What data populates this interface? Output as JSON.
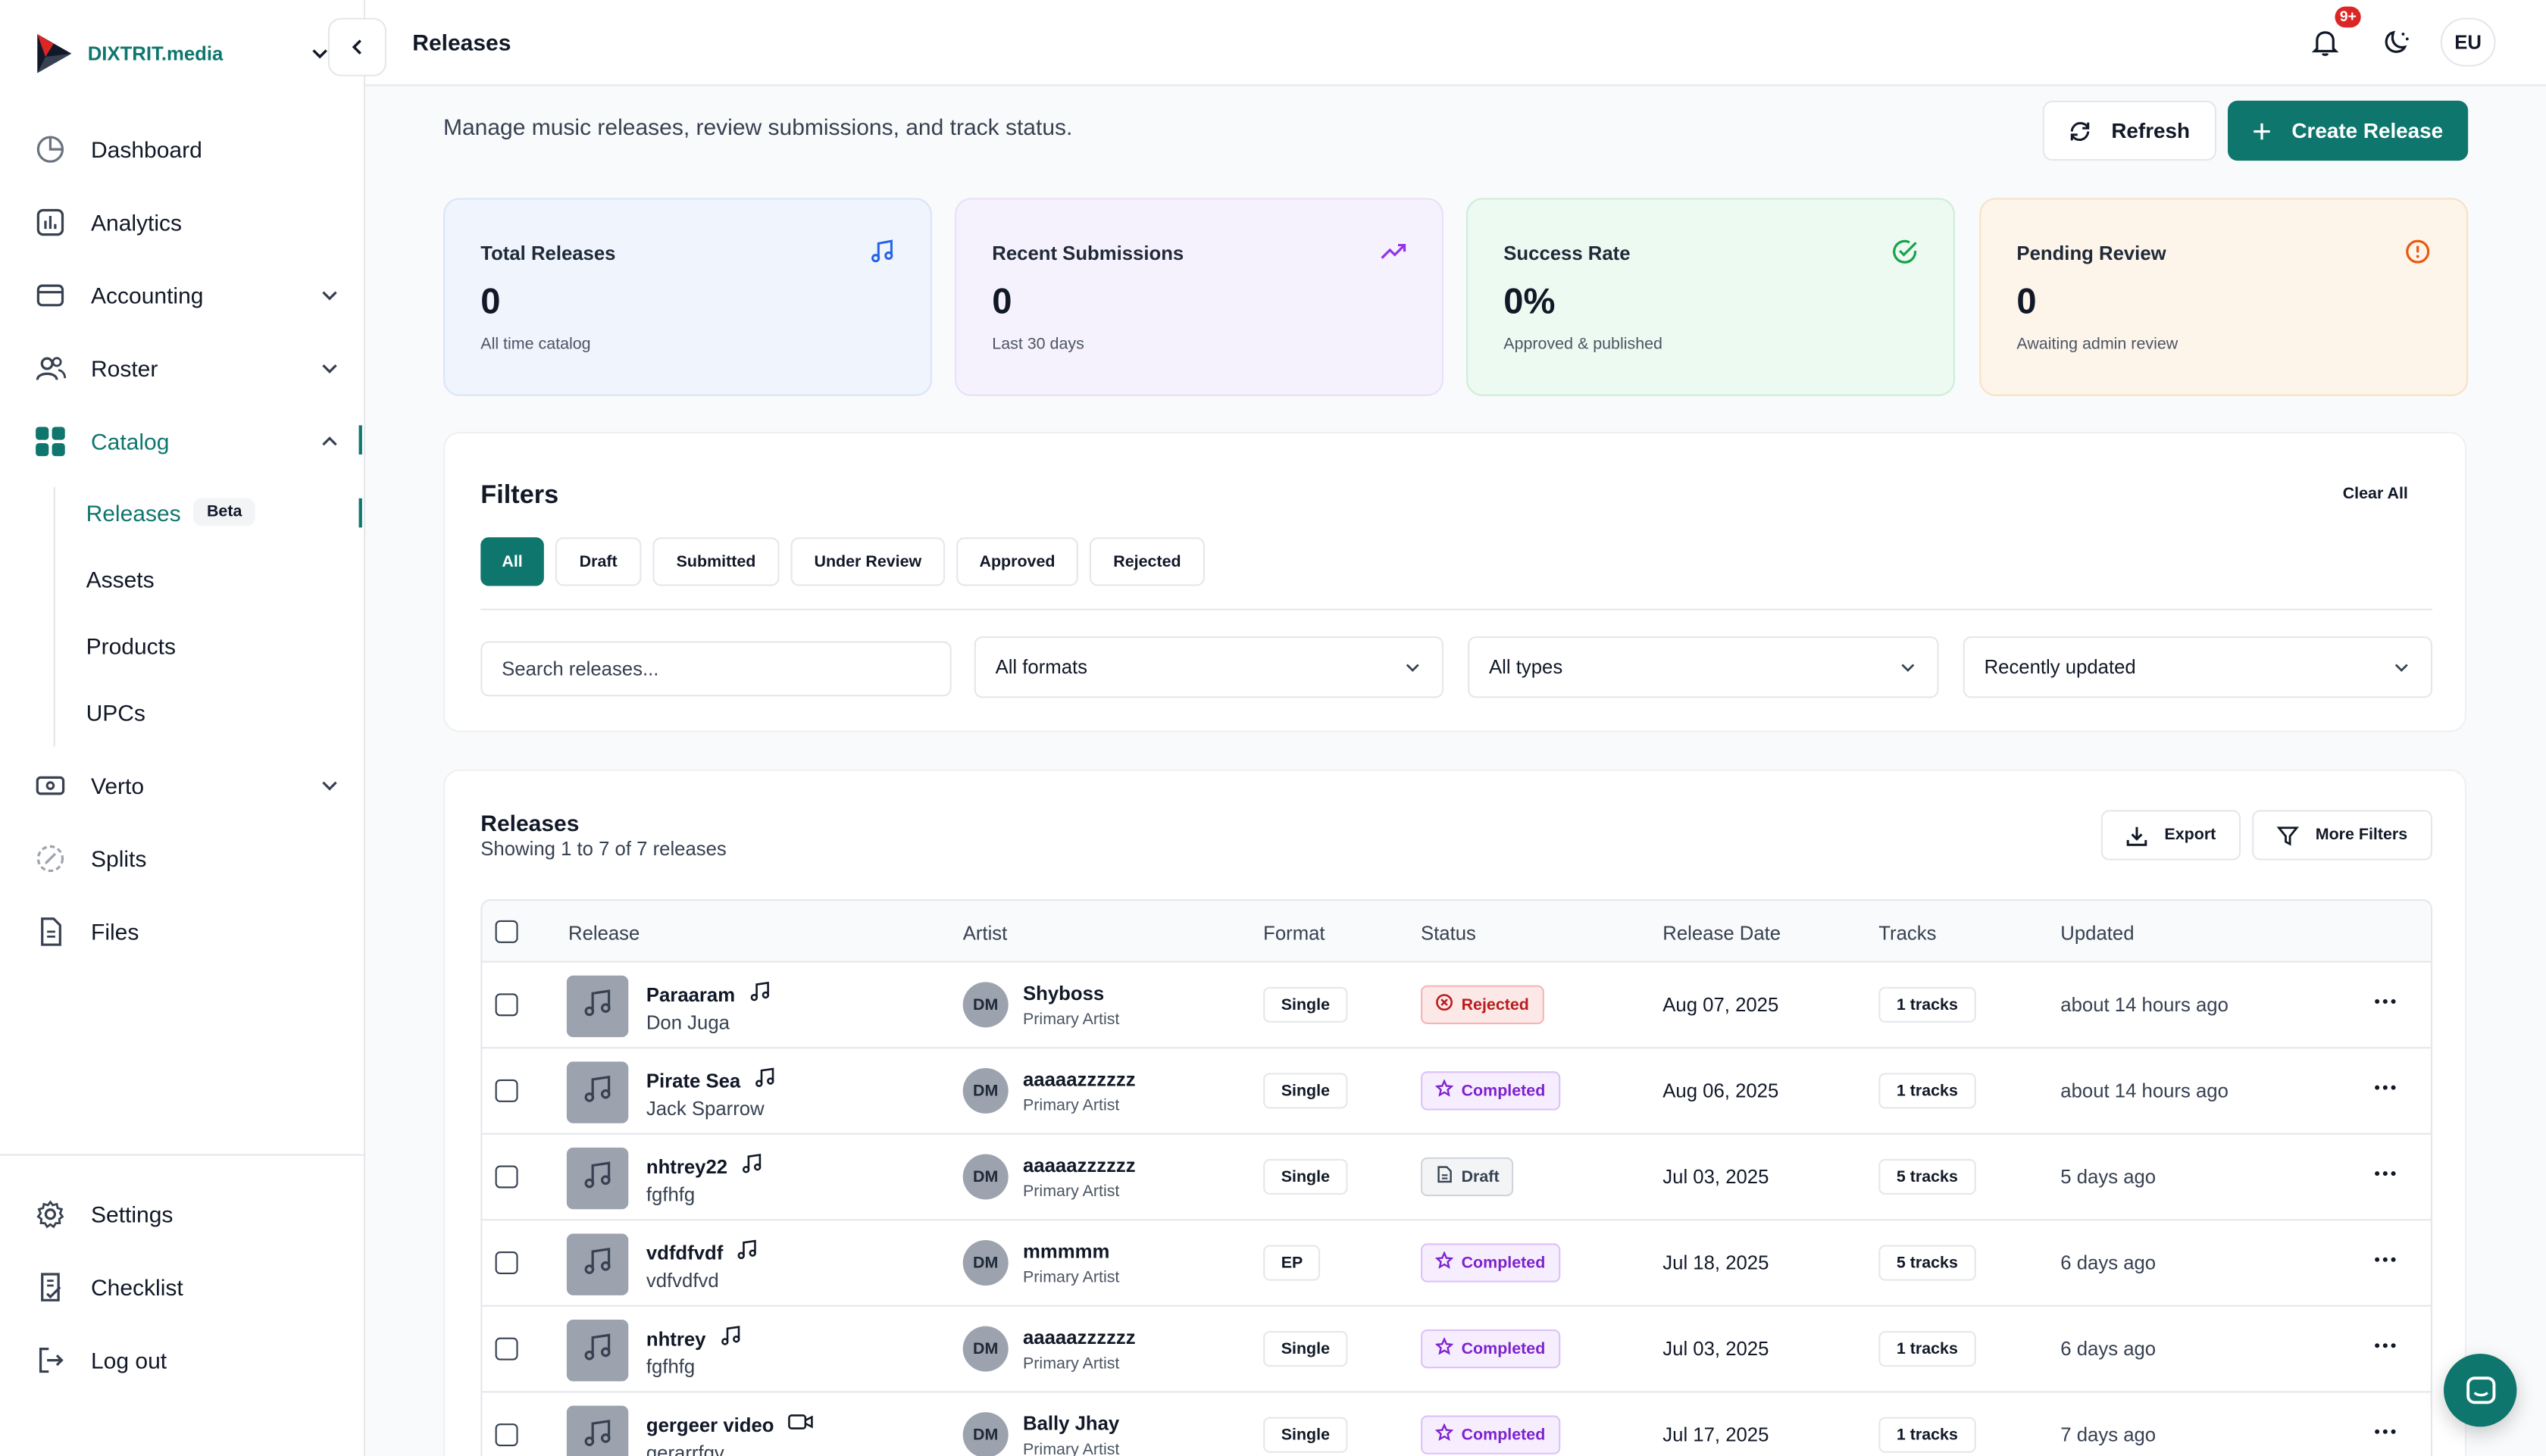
{
  "brand": {
    "name": "DIXTRIT.media"
  },
  "header": {
    "title": "Releases",
    "notification_badge": "9+",
    "user_initials": "EU"
  },
  "sidebar": {
    "nav": [
      {
        "label": "Dashboard",
        "icon": "pie-chart-icon"
      },
      {
        "label": "Analytics",
        "icon": "bar-chart-icon"
      },
      {
        "label": "Accounting",
        "icon": "wallet-icon"
      },
      {
        "label": "Roster",
        "icon": "users-icon"
      },
      {
        "label": "Catalog",
        "icon": "grid-icon"
      }
    ],
    "catalog_sub": [
      {
        "label": "Releases",
        "badge": "Beta"
      },
      {
        "label": "Assets"
      },
      {
        "label": "Products"
      },
      {
        "label": "UPCs"
      }
    ],
    "nav2": [
      {
        "label": "Verto",
        "icon": "card-icon"
      },
      {
        "label": "Splits",
        "icon": "split-icon"
      },
      {
        "label": "Files",
        "icon": "file-icon"
      }
    ],
    "footer": [
      {
        "label": "Settings",
        "icon": "gear-icon"
      },
      {
        "label": "Checklist",
        "icon": "checklist-icon"
      },
      {
        "label": "Log out",
        "icon": "logout-icon"
      }
    ]
  },
  "page": {
    "subtitle": "Manage music releases, review submissions, and track status.",
    "refresh_label": "Refresh",
    "create_label": "Create Release"
  },
  "stats": [
    {
      "title": "Total Releases",
      "value": "0",
      "desc": "All time catalog",
      "icon": "music-note-icon",
      "color": "#2563eb"
    },
    {
      "title": "Recent Submissions",
      "value": "0",
      "desc": "Last 30 days",
      "icon": "trending-up-icon",
      "color": "#9333ea"
    },
    {
      "title": "Success Rate",
      "value": "0%",
      "desc": "Approved & published",
      "icon": "check-circle-icon",
      "color": "#16a34a"
    },
    {
      "title": "Pending Review",
      "value": "0",
      "desc": "Awaiting admin review",
      "icon": "alert-circle-icon",
      "color": "#ea580c"
    }
  ],
  "filters": {
    "title": "Filters",
    "clear_all": "Clear All",
    "pills": [
      "All",
      "Draft",
      "Submitted",
      "Under Review",
      "Approved",
      "Rejected"
    ],
    "active_pill": "All",
    "search_placeholder": "Search releases...",
    "format_select": "All formats",
    "type_select": "All types",
    "sort_select": "Recently updated"
  },
  "releases": {
    "title": "Releases",
    "showing": "Showing 1 to 7 of 7 releases",
    "export_label": "Export",
    "more_filters_label": "More Filters",
    "columns": [
      "Release",
      "Artist",
      "Format",
      "Status",
      "Release Date",
      "Tracks",
      "Updated"
    ],
    "rows": [
      {
        "name": "Paraaram",
        "sub": "Don Juga",
        "media": "audio",
        "initials": "DM",
        "artist": "Shyboss",
        "role": "Primary Artist",
        "format": "Single",
        "status": "Rejected",
        "status_kind": "rejected",
        "date": "Aug 07, 2025",
        "tracks": "1 tracks",
        "updated": "about 14 hours ago"
      },
      {
        "name": "Pirate Sea",
        "sub": "Jack Sparrow",
        "media": "audio",
        "initials": "DM",
        "artist": "aaaaazzzzzz",
        "role": "Primary Artist",
        "format": "Single",
        "status": "Completed",
        "status_kind": "completed",
        "date": "Aug 06, 2025",
        "tracks": "1 tracks",
        "updated": "about 14 hours ago"
      },
      {
        "name": "nhtrey22",
        "sub": "fgfhfg",
        "media": "audio",
        "initials": "DM",
        "artist": "aaaaazzzzzz",
        "role": "Primary Artist",
        "format": "Single",
        "status": "Draft",
        "status_kind": "draft",
        "date": "Jul 03, 2025",
        "tracks": "5 tracks",
        "updated": "5 days ago"
      },
      {
        "name": "vdfdfvdf",
        "sub": "vdfvdfvd",
        "media": "audio",
        "initials": "DM",
        "artist": "mmmmm",
        "role": "Primary Artist",
        "format": "EP",
        "status": "Completed",
        "status_kind": "completed",
        "date": "Jul 18, 2025",
        "tracks": "5 tracks",
        "updated": "6 days ago"
      },
      {
        "name": "nhtrey",
        "sub": "fgfhfg",
        "media": "audio",
        "initials": "DM",
        "artist": "aaaaazzzzzz",
        "role": "Primary Artist",
        "format": "Single",
        "status": "Completed",
        "status_kind": "completed",
        "date": "Jul 03, 2025",
        "tracks": "1 tracks",
        "updated": "6 days ago"
      },
      {
        "name": "gergeer video",
        "sub": "gerarrfgv",
        "media": "video",
        "initials": "DM",
        "artist": "Bally Jhay",
        "role": "Primary Artist",
        "format": "Single",
        "status": "Completed",
        "status_kind": "completed",
        "date": "Jul 17, 2025",
        "tracks": "1 tracks",
        "updated": "7 days ago"
      }
    ]
  },
  "colors": {
    "brand": "#0f766e",
    "text": "#111827",
    "border": "#e5e7eb"
  }
}
